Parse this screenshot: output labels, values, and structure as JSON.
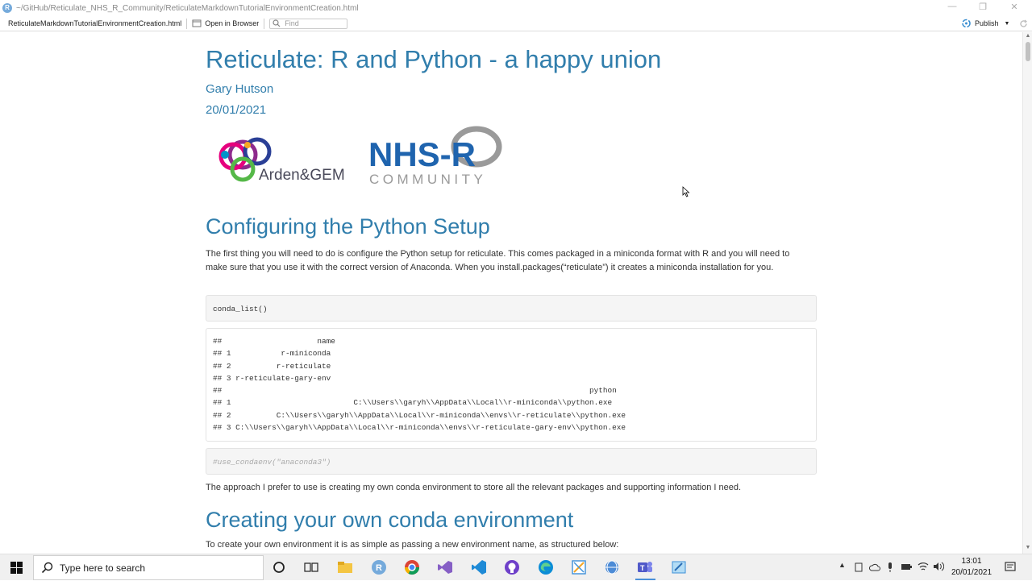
{
  "window": {
    "path": "~/GitHub/Reticulate_NHS_R_Community/ReticulateMarkdownTutorialEnvironmentCreation.html"
  },
  "toolbar": {
    "filename": "ReticulateMarkdownTutorialEnvironmentCreation.html",
    "open_in_browser": "Open in Browser",
    "find_placeholder": "Find",
    "publish": "Publish"
  },
  "document": {
    "title": "Reticulate: R and Python - a happy union",
    "author": "Gary Hutson",
    "date": "20/01/2021",
    "logos": {
      "arden": "Arden&GEM",
      "nhs_top": "NHS-R",
      "nhs_bottom": "COMMUNITY"
    },
    "section1_heading": "Configuring the Python Setup",
    "section1_para": "The first thing you will need to do is configure the Python setup for reticulate. This comes packaged in a miniconda format with R and you will need to make sure that you use it with the correct version of Anaconda. When you install.packages(“reticulate”) it creates a miniconda installation for you.",
    "code1": "conda_list()",
    "output1": "##                     name\n## 1           r-miniconda\n## 2          r-reticulate\n## 3 r-reticulate-gary-env\n##                                                                                 python\n## 1                           C:\\\\Users\\\\garyh\\\\AppData\\\\Local\\\\r-miniconda\\\\python.exe\n## 2          C:\\\\Users\\\\garyh\\\\AppData\\\\Local\\\\r-miniconda\\\\envs\\\\r-reticulate\\\\python.exe\n## 3 C:\\\\Users\\\\garyh\\\\AppData\\\\Local\\\\r-miniconda\\\\envs\\\\r-reticulate-gary-env\\\\python.exe",
    "code2": "#use_condaenv(\"anaconda3\")",
    "para2": "The approach I prefer to use is creating my own conda environment to store all the relevant packages and supporting information I need.",
    "section2_heading": "Creating your own conda environment",
    "para3": "To create your own environment it is as simple as passing a new environment name, as structured below:"
  },
  "taskbar": {
    "search_placeholder": "Type here to search",
    "time": "13:01",
    "date": "20/01/2021"
  },
  "colors": {
    "heading": "#317eac",
    "text": "#333333",
    "code_bg": "#f5f5f5"
  }
}
